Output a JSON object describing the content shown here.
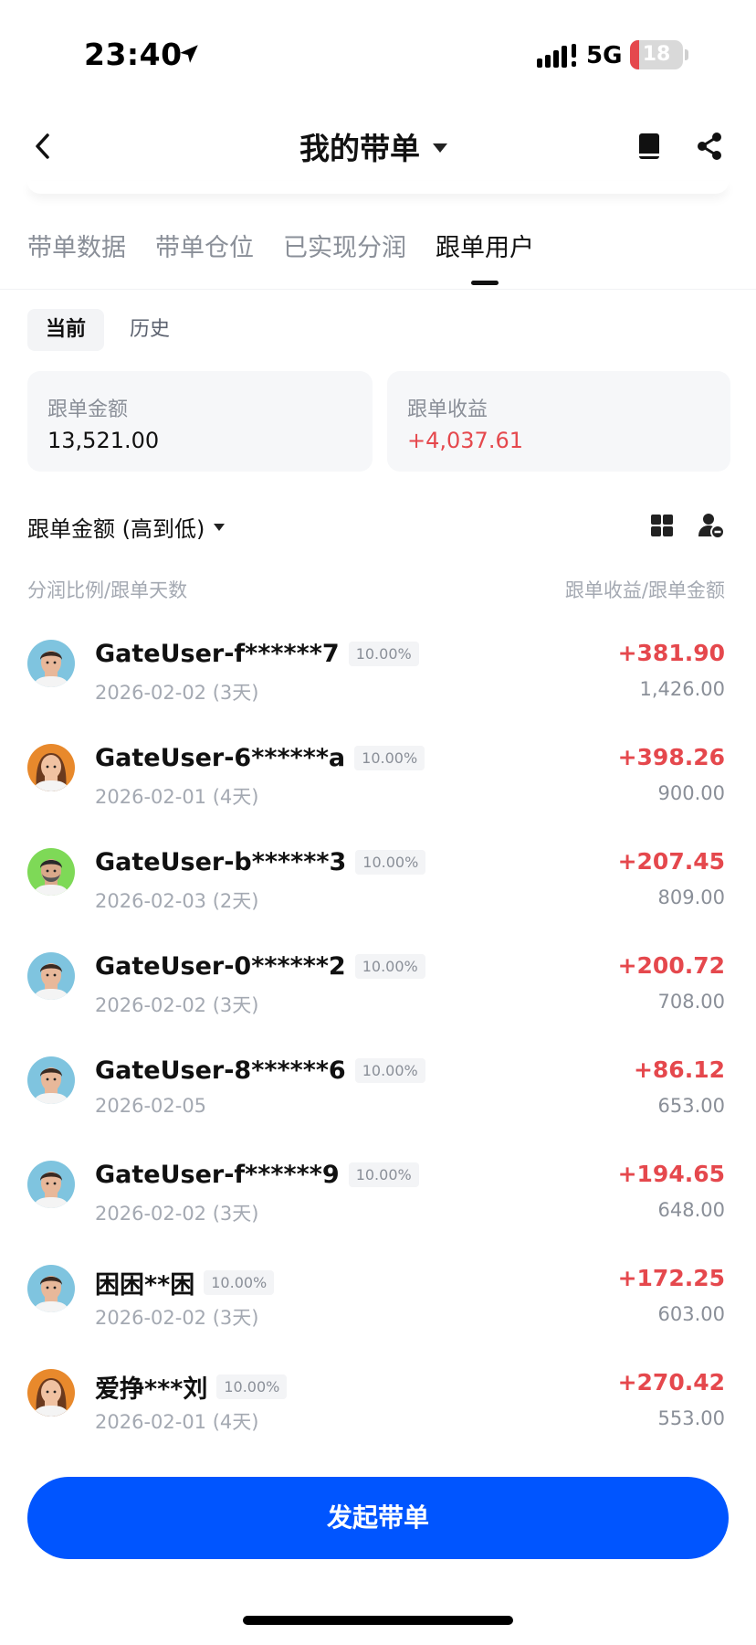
{
  "status_bar": {
    "time": "23:40",
    "network": "5G",
    "battery": "18",
    "battery_level": 0.18
  },
  "nav": {
    "title": "我的带单",
    "back_icon": "chevron-left-icon",
    "book_icon": "book-icon",
    "share_icon": "share-icon"
  },
  "tabs": [
    {
      "label": "带单数据",
      "active": false
    },
    {
      "label": "带单仓位",
      "active": false
    },
    {
      "label": "已实现分润",
      "active": false
    },
    {
      "label": "跟单用户",
      "active": true
    }
  ],
  "segment": [
    {
      "label": "当前",
      "active": true
    },
    {
      "label": "历史",
      "active": false
    }
  ],
  "summary": {
    "amount_label": "跟单金额",
    "amount_value": "13,521.00",
    "profit_label": "跟单收益",
    "profit_value": "+4,037.61"
  },
  "sort": {
    "label": "跟单金额 (高到低)"
  },
  "columns": {
    "left": "分润比例/跟单天数",
    "right": "跟单收益/跟单金额"
  },
  "followers": [
    {
      "name": "GateUser-f******7",
      "ratio": "10.00%",
      "date": "2026-02-02 (3天)",
      "profit": "+381.90",
      "amount": "1,426.00",
      "avatar": "male-blue"
    },
    {
      "name": "GateUser-6******a",
      "ratio": "10.00%",
      "date": "2026-02-01 (4天)",
      "profit": "+398.26",
      "amount": "900.00",
      "avatar": "female-orange"
    },
    {
      "name": "GateUser-b******3",
      "ratio": "10.00%",
      "date": "2026-02-03 (2天)",
      "profit": "+207.45",
      "amount": "809.00",
      "avatar": "male-green"
    },
    {
      "name": "GateUser-0******2",
      "ratio": "10.00%",
      "date": "2026-02-02 (3天)",
      "profit": "+200.72",
      "amount": "708.00",
      "avatar": "male-blue"
    },
    {
      "name": "GateUser-8******6",
      "ratio": "10.00%",
      "date": "2026-02-05",
      "profit": "+86.12",
      "amount": "653.00",
      "avatar": "male-blue"
    },
    {
      "name": "GateUser-f******9",
      "ratio": "10.00%",
      "date": "2026-02-02 (3天)",
      "profit": "+194.65",
      "amount": "648.00",
      "avatar": "male-blue"
    },
    {
      "name": "困困**困",
      "ratio": "10.00%",
      "date": "2026-02-02 (3天)",
      "profit": "+172.25",
      "amount": "603.00",
      "avatar": "male-blue"
    },
    {
      "name": "爱挣***刘",
      "ratio": "10.00%",
      "date": "2026-02-01 (4天)",
      "profit": "+270.42",
      "amount": "553.00",
      "avatar": "female-orange"
    }
  ],
  "cta": {
    "label": "发起带单"
  },
  "colors": {
    "accent": "#0055ff",
    "profit": "#e5484d"
  }
}
